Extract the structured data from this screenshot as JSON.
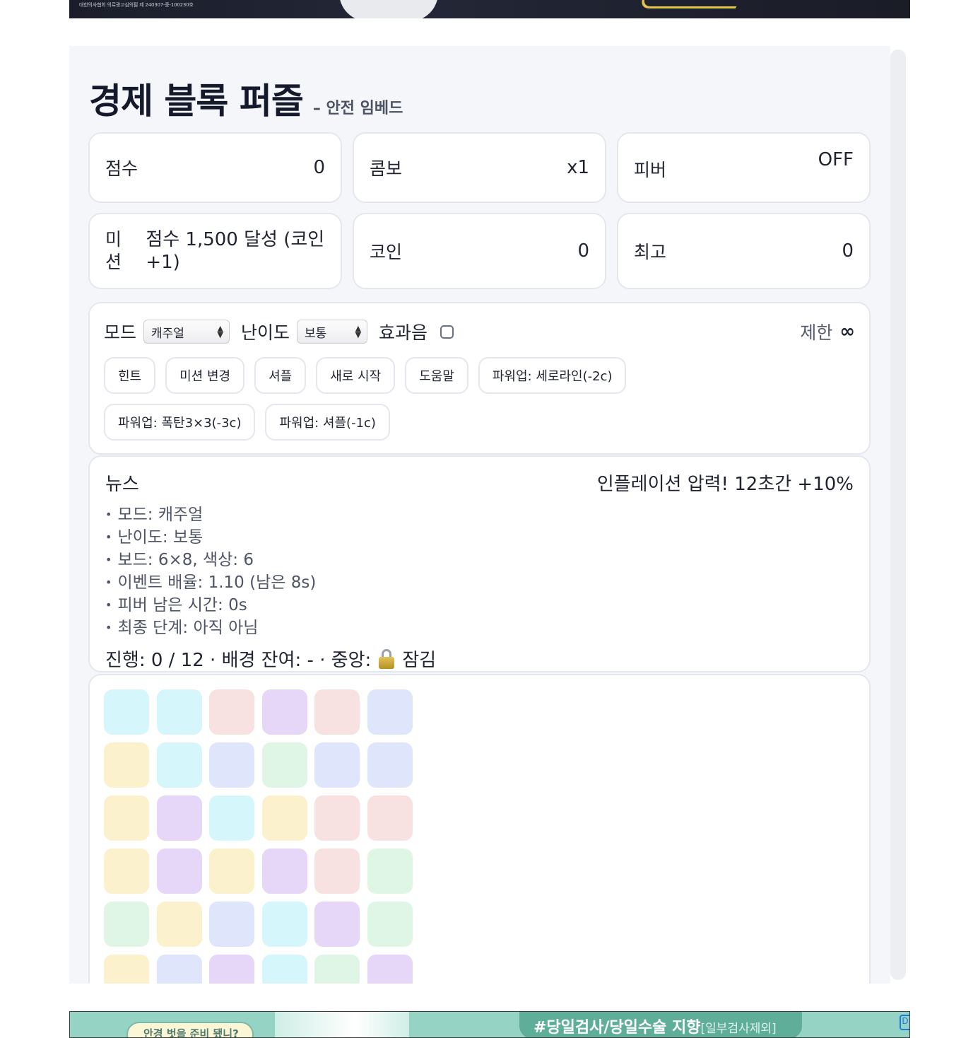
{
  "ads": {
    "top_fine_print": "대한의사협회 의료광고심의필 제 240307-중-100230호",
    "bottom_bubble": "안경 벗을 준비 됐니?",
    "bottom_tag": "#당일검사/당일수술 지향",
    "bottom_tag_small": "[일부검사제외]",
    "bottom_corner": "D"
  },
  "header": {
    "title": "경제 블록 퍼즐",
    "subtitle": "– 안전 임베드"
  },
  "stats": {
    "score": {
      "label": "점수",
      "value": "0"
    },
    "combo": {
      "label": "콤보",
      "value": "x1"
    },
    "fever": {
      "label": "피버",
      "value": "OFF"
    },
    "mission": {
      "label": "미션",
      "value": "점수 1,500 달성 (코인 +1)"
    },
    "coin": {
      "label": "코인",
      "value": "0"
    },
    "best": {
      "label": "최고",
      "value": "0"
    }
  },
  "controls": {
    "mode_label": "모드",
    "mode_value": "캐주얼",
    "difficulty_label": "난이도",
    "difficulty_value": "보통",
    "sound_label": "효과음",
    "sound_checked": false,
    "limit_label": "제한",
    "limit_value": "∞",
    "buttons": [
      "힌트",
      "미션 변경",
      "셔플",
      "새로 시작",
      "도움말",
      "파워업: 세로라인(-2c)",
      "파워업: 폭탄3×3(-3c)",
      "파워업: 셔플(-1c)"
    ]
  },
  "news": {
    "heading": "뉴스",
    "event": "인플레이션 압력! 12초간 +10%",
    "items": [
      "모드: 캐주얼",
      "난이도: 보통",
      "보드: 6×8, 색상: 6",
      "이벤트 배율: 1.10 (남은 8s)",
      "피버 남은 시간: 0s",
      "최종 단계: 아직 아님"
    ],
    "progress_prefix": "진행: 0 / 12 · 배경 잔여: - · 중앙:",
    "progress_lock_icon": "lock-icon",
    "progress_suffix": "잠김"
  },
  "board": {
    "cols": 6,
    "rows": 8,
    "palette": {
      "cyan": "#d5f6fb",
      "pink": "#f7e1e1",
      "purple": "#e6d7f8",
      "blue": "#dfe5fb",
      "yellow": "#fbf1cc",
      "green": "#dff6e6"
    },
    "tiles": [
      [
        "cyan",
        "cyan",
        "pink",
        "purple",
        "pink",
        "blue"
      ],
      [
        "yellow",
        "cyan",
        "blue",
        "green",
        "blue",
        "blue"
      ],
      [
        "yellow",
        "purple",
        "cyan",
        "yellow",
        "pink",
        "pink"
      ],
      [
        "yellow",
        "purple",
        "yellow",
        "purple",
        "pink",
        "green"
      ],
      [
        "green",
        "yellow",
        "blue",
        "cyan",
        "purple",
        "green"
      ],
      [
        "yellow",
        "blue",
        "purple",
        "cyan",
        "green",
        "purple"
      ]
    ]
  }
}
